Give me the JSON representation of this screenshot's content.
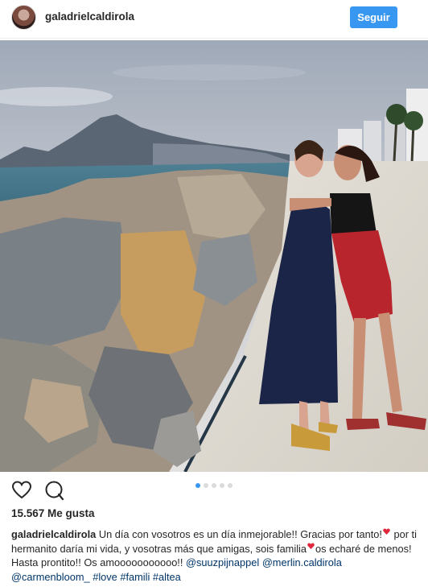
{
  "header": {
    "username": "galadrielcaldirola",
    "follow_label": "Seguir"
  },
  "icons": {
    "like": "heart-icon",
    "comment": "comment-icon"
  },
  "colors": {
    "accent": "#3897f0",
    "link": "#003569",
    "text": "#262626"
  },
  "carousel": {
    "count": 5,
    "active_index": 0
  },
  "likes_text": "15.567 Me gusta",
  "caption": {
    "username": "galadrielcaldirola",
    "line1": "Un día con vosotros es un día inmejorable!! Gracias por tanto!",
    "line2": "por ti hermanito daría mi vida, y vosotras más que amigas, sois familia",
    "line2b": "os echaré",
    "line3": "de menos! Hasta prontito!! Os amooooooooooo!!",
    "mention1": "@suuzpijnappel",
    "mention2": "@merlin.caldirola",
    "mention3": "@carmenbloom_",
    "tag1": "#love",
    "tag2": "#famili",
    "tag3": "#altea"
  }
}
